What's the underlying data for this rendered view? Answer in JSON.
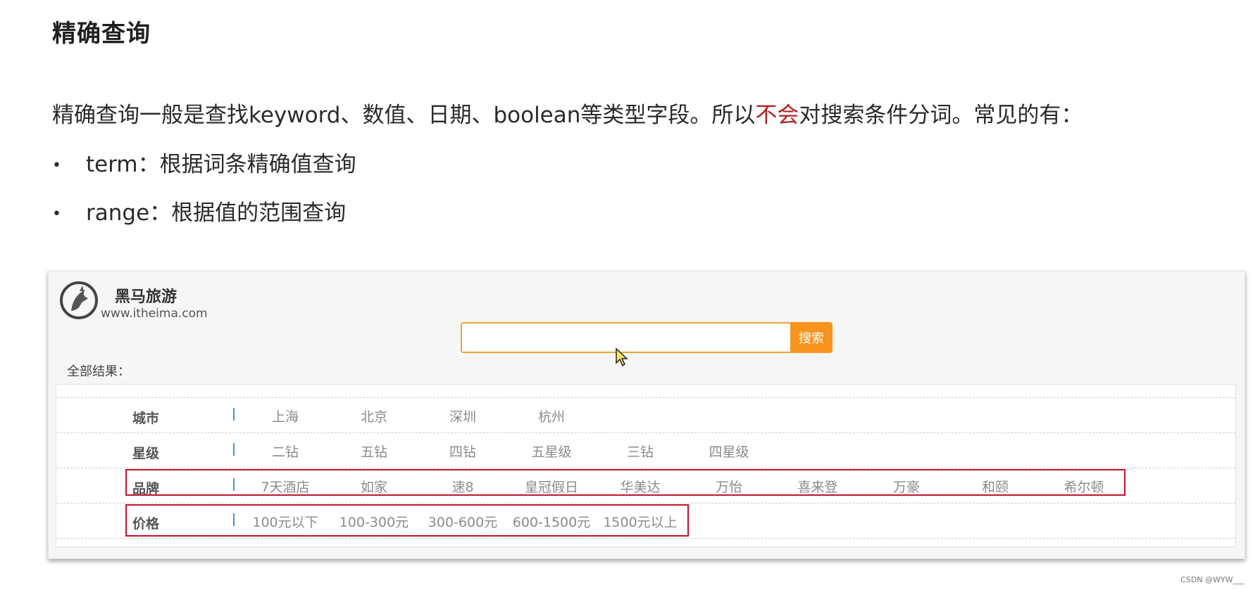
{
  "heading": "精确查询",
  "intro": {
    "before": "精确查询一般是查找keyword、数值、日期、boolean等类型字段。所以",
    "highlight": "不会",
    "after": "对搜索条件分词。常见的有："
  },
  "bullets": [
    {
      "name": "term：",
      "desc": "根据词条精确值查询"
    },
    {
      "name": "range：",
      "desc": "根据值的范围查询"
    }
  ],
  "panel": {
    "brand_name": "黑马旅游",
    "brand_url": "www.itheima.com",
    "search": {
      "placeholder": "",
      "button": "搜索"
    },
    "results_label": "全部结果：",
    "filters": [
      {
        "label": "城市",
        "options": [
          "上海",
          "北京",
          "深圳",
          "杭州"
        ]
      },
      {
        "label": "星级",
        "options": [
          "二钻",
          "五钻",
          "四钻",
          "五星级",
          "三钻",
          "四星级"
        ]
      },
      {
        "label": "品牌",
        "options": [
          "7天酒店",
          "如家",
          "速8",
          "皇冠假日",
          "华美达",
          "万怡",
          "喜来登",
          "万豪",
          "和颐",
          "希尔顿"
        ]
      },
      {
        "label": "价格",
        "options": [
          "100元以下",
          "100-300元",
          "300-600元",
          "600-1500元",
          "1500元以上"
        ]
      }
    ]
  },
  "colors": {
    "highlight_text": "#b22222",
    "search_button": "#f7941d",
    "highlight_box": "#c8102e"
  },
  "watermark": "CSDN @WYW___"
}
